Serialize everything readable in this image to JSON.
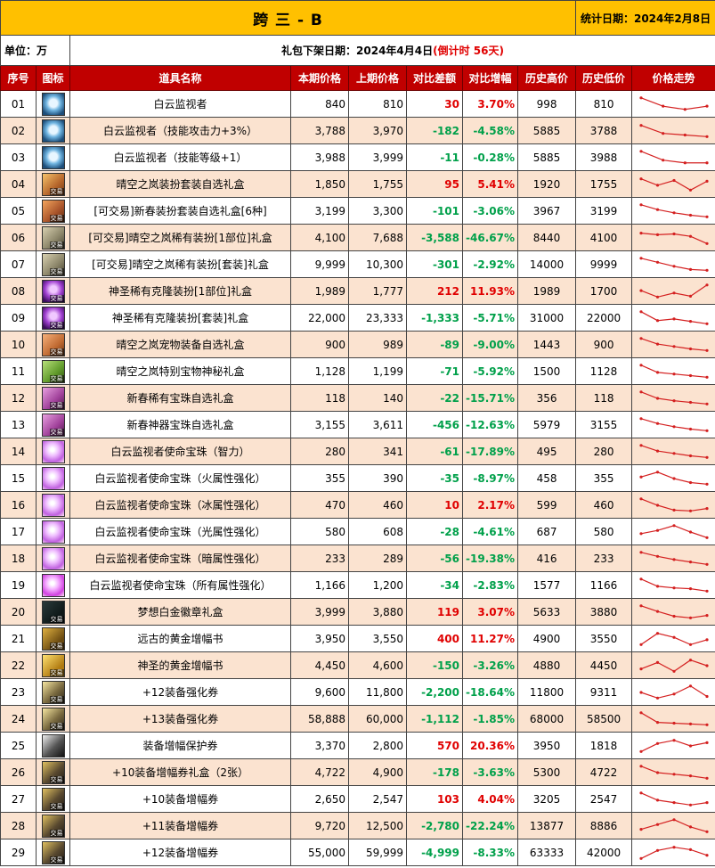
{
  "title": "跨 三 - B",
  "stat_date": "统计日期：2024年2月8日",
  "unit": "单位：万",
  "release_prefix": "礼包下架日期：2024年4月4日",
  "release_countdown": "(倒计时 56天)",
  "headers": [
    "序号",
    "图标",
    "道具名称",
    "本期价格",
    "上期价格",
    "对比差额",
    "对比增幅",
    "历史高价",
    "历史低价",
    "价格走势"
  ],
  "icon_tag": "交易",
  "colors": {
    "title_bg": "#ffc000",
    "header_bg": "#c00000",
    "alt_row": "#fbe3d0",
    "up": "#e00000",
    "down": "#00a04a",
    "trend_line": "#d42020"
  },
  "rows": [
    {
      "no": "01",
      "icon": "cloud-watcher-armor-icon",
      "name": "白云监视者",
      "cur": "840",
      "prev": "810",
      "diff": "30",
      "pct": "3.70%",
      "high": "998",
      "low": "810",
      "trend": [
        0.1,
        0.62,
        0.82,
        0.62
      ]
    },
    {
      "no": "02",
      "icon": "cloud-watcher-armor-icon",
      "name": "白云监视者（技能攻击力+3%）",
      "cur": "3,788",
      "prev": "3,970",
      "diff": "-182",
      "pct": "-4.58%",
      "high": "5885",
      "low": "3788",
      "trend": [
        0.15,
        0.65,
        0.75,
        0.85
      ]
    },
    {
      "no": "03",
      "icon": "cloud-watcher-armor-icon",
      "name": "白云监视者（技能等级+1）",
      "cur": "3,988",
      "prev": "3,999",
      "diff": "-11",
      "pct": "-0.28%",
      "high": "5885",
      "low": "3988",
      "trend": [
        0.1,
        0.65,
        0.82,
        0.82
      ]
    },
    {
      "no": "04",
      "icon": "clear-sky-avatar-box-icon",
      "name": "晴空之岚装扮套装自选礼盒",
      "cur": "1,850",
      "prev": "1,755",
      "diff": "95",
      "pct": "5.41%",
      "high": "1920",
      "low": "1755",
      "trend": [
        0.15,
        0.55,
        0.25,
        0.85,
        0.3
      ]
    },
    {
      "no": "05",
      "icon": "spring-avatar-box-icon",
      "name": "[可交易]新春装扮套装自选礼盒[6种]",
      "cur": "3,199",
      "prev": "3,300",
      "diff": "-101",
      "pct": "-3.06%",
      "high": "3967",
      "low": "3199",
      "trend": [
        0.1,
        0.4,
        0.6,
        0.75,
        0.85
      ]
    },
    {
      "no": "06",
      "icon": "rare-avatar-box-icon",
      "name": "[可交易]晴空之岚稀有装扮[1部位]礼盒",
      "cur": "4,100",
      "prev": "7,688",
      "diff": "-3,588",
      "pct": "-46.67%",
      "high": "8440",
      "low": "4100",
      "trend": [
        0.2,
        0.3,
        0.25,
        0.4,
        0.85
      ]
    },
    {
      "no": "07",
      "icon": "rare-avatar-set-box-icon",
      "name": "[可交易]晴空之岚稀有装扮[套装]礼盒",
      "cur": "9,999",
      "prev": "10,300",
      "diff": "-301",
      "pct": "-2.92%",
      "high": "14000",
      "low": "9999",
      "trend": [
        0.1,
        0.35,
        0.6,
        0.8,
        0.85
      ]
    },
    {
      "no": "08",
      "icon": "divine-clone-avatar-icon",
      "name": "神圣稀有克隆装扮[1部位]礼盒",
      "cur": "1,989",
      "prev": "1,777",
      "diff": "212",
      "pct": "11.93%",
      "high": "1989",
      "low": "1700",
      "trend": [
        0.45,
        0.85,
        0.6,
        0.8,
        0.1
      ]
    },
    {
      "no": "09",
      "icon": "divine-clone-set-icon",
      "name": "神圣稀有克隆装扮[套装]礼盒",
      "cur": "22,000",
      "prev": "23,333",
      "diff": "-1,333",
      "pct": "-5.71%",
      "high": "31000",
      "low": "22000",
      "trend": [
        0.1,
        0.65,
        0.55,
        0.7,
        0.85
      ]
    },
    {
      "no": "10",
      "icon": "pet-equipment-box-icon",
      "name": "晴空之岚宠物装备自选礼盒",
      "cur": "900",
      "prev": "989",
      "diff": "-89",
      "pct": "-9.00%",
      "high": "1443",
      "low": "900",
      "trend": [
        0.1,
        0.45,
        0.6,
        0.75,
        0.85
      ]
    },
    {
      "no": "11",
      "icon": "pet-treasure-box-icon",
      "name": "晴空之岚特别宝物神秘礼盒",
      "cur": "1,128",
      "prev": "1,199",
      "diff": "-71",
      "pct": "-5.92%",
      "high": "1500",
      "low": "1128",
      "trend": [
        0.1,
        0.55,
        0.65,
        0.75,
        0.85
      ]
    },
    {
      "no": "12",
      "icon": "spring-gem-box-icon",
      "name": "新春稀有宝珠自选礼盒",
      "cur": "118",
      "prev": "140",
      "diff": "-22",
      "pct": "-15.71%",
      "high": "356",
      "low": "118",
      "trend": [
        0.1,
        0.5,
        0.65,
        0.75,
        0.85
      ]
    },
    {
      "no": "13",
      "icon": "spring-artifact-gem-box-icon",
      "name": "新春神器宝珠自选礼盒",
      "cur": "3,155",
      "prev": "3,611",
      "diff": "-456",
      "pct": "-12.63%",
      "high": "5979",
      "low": "3155",
      "trend": [
        0.1,
        0.4,
        0.6,
        0.75,
        0.85
      ]
    },
    {
      "no": "14",
      "icon": "mission-orb-icon",
      "name": "白云监视者使命宝珠（智力）",
      "cur": "280",
      "prev": "341",
      "diff": "-61",
      "pct": "-17.89%",
      "high": "495",
      "low": "280",
      "trend": [
        0.1,
        0.45,
        0.6,
        0.75,
        0.85
      ]
    },
    {
      "no": "15",
      "icon": "mission-orb-icon",
      "name": "白云监视者使命宝珠（火属性强化）",
      "cur": "355",
      "prev": "390",
      "diff": "-35",
      "pct": "-8.97%",
      "high": "458",
      "low": "355",
      "trend": [
        0.4,
        0.1,
        0.5,
        0.75,
        0.85
      ]
    },
    {
      "no": "16",
      "icon": "mission-orb-icon",
      "name": "白云监视者使命宝珠（冰属性强化）",
      "cur": "470",
      "prev": "460",
      "diff": "10",
      "pct": "2.17%",
      "high": "599",
      "low": "460",
      "trend": [
        0.1,
        0.5,
        0.8,
        0.85,
        0.7
      ]
    },
    {
      "no": "17",
      "icon": "mission-orb-icon",
      "name": "白云监视者使命宝珠（光属性强化）",
      "cur": "580",
      "prev": "608",
      "diff": "-28",
      "pct": "-4.61%",
      "high": "687",
      "low": "580",
      "trend": [
        0.6,
        0.4,
        0.1,
        0.5,
        0.85
      ]
    },
    {
      "no": "18",
      "icon": "mission-orb-icon",
      "name": "白云监视者使命宝珠（暗属性强化）",
      "cur": "233",
      "prev": "289",
      "diff": "-56",
      "pct": "-19.38%",
      "high": "416",
      "low": "233",
      "trend": [
        0.1,
        0.35,
        0.55,
        0.7,
        0.85
      ]
    },
    {
      "no": "19",
      "icon": "mission-orb-all-icon",
      "name": "白云监视者使命宝珠（所有属性强化）",
      "cur": "1,166",
      "prev": "1,200",
      "diff": "-34",
      "pct": "-2.83%",
      "high": "1577",
      "low": "1166",
      "trend": [
        0.1,
        0.55,
        0.65,
        0.7,
        0.85
      ]
    },
    {
      "no": "20",
      "icon": "platinum-emblem-box-icon",
      "name": "梦想白金徽章礼盒",
      "cur": "3,999",
      "prev": "3,880",
      "diff": "119",
      "pct": "3.07%",
      "high": "5633",
      "low": "3880",
      "trend": [
        0.1,
        0.45,
        0.75,
        0.85,
        0.7
      ]
    },
    {
      "no": "21",
      "icon": "ancient-amplify-book-icon",
      "name": "远古的黄金增幅书",
      "cur": "3,950",
      "prev": "3,550",
      "diff": "400",
      "pct": "11.27%",
      "high": "4900",
      "low": "3550",
      "trend": [
        0.85,
        0.15,
        0.4,
        0.85,
        0.55
      ]
    },
    {
      "no": "22",
      "icon": "divine-amplify-book-icon",
      "name": "神圣的黄金增幅书",
      "cur": "4,450",
      "prev": "4,600",
      "diff": "-150",
      "pct": "-3.26%",
      "high": "4880",
      "low": "4450",
      "trend": [
        0.7,
        0.3,
        0.85,
        0.15,
        0.5
      ]
    },
    {
      "no": "23",
      "icon": "plus12-reinforce-ticket-icon",
      "name": "+12装备强化券",
      "cur": "9,600",
      "prev": "11,800",
      "diff": "-2,200",
      "pct": "-18.64%",
      "high": "11800",
      "low": "9311",
      "trend": [
        0.5,
        0.85,
        0.6,
        0.1,
        0.75
      ]
    },
    {
      "no": "24",
      "icon": "plus13-reinforce-ticket-icon",
      "name": "+13装备强化券",
      "cur": "58,888",
      "prev": "60,000",
      "diff": "-1,112",
      "pct": "-1.85%",
      "high": "68000",
      "low": "58500",
      "trend": [
        0.1,
        0.7,
        0.75,
        0.8,
        0.85
      ]
    },
    {
      "no": "25",
      "icon": "amplify-protection-ticket-icon",
      "name": "装备增幅保护券",
      "cur": "3,370",
      "prev": "2,800",
      "diff": "570",
      "pct": "20.36%",
      "high": "3950",
      "low": "1818",
      "trend": [
        0.85,
        0.35,
        0.15,
        0.5,
        0.3
      ]
    },
    {
      "no": "26",
      "icon": "plus10-amplify-box-icon",
      "name": "+10装备增幅券礼盒（2张）",
      "cur": "4,722",
      "prev": "4,900",
      "diff": "-178",
      "pct": "-3.63%",
      "high": "5300",
      "low": "4722",
      "trend": [
        0.1,
        0.5,
        0.6,
        0.7,
        0.85
      ]
    },
    {
      "no": "27",
      "icon": "plus10-amplify-ticket-icon",
      "name": "+10装备增幅券",
      "cur": "2,650",
      "prev": "2,547",
      "diff": "103",
      "pct": "4.04%",
      "high": "3205",
      "low": "2547",
      "trend": [
        0.1,
        0.55,
        0.7,
        0.85,
        0.7
      ]
    },
    {
      "no": "28",
      "icon": "plus11-amplify-ticket-icon",
      "name": "+11装备增幅券",
      "cur": "9,720",
      "prev": "12,500",
      "diff": "-2,780",
      "pct": "-22.24%",
      "high": "13877",
      "low": "8886",
      "trend": [
        0.7,
        0.4,
        0.1,
        0.55,
        0.85
      ]
    },
    {
      "no": "29",
      "icon": "plus12-amplify-ticket-icon",
      "name": "+12装备增幅券",
      "cur": "55,000",
      "prev": "59,999",
      "diff": "-4,999",
      "pct": "-8.33%",
      "high": "63333",
      "low": "42000",
      "trend": [
        0.85,
        0.35,
        0.15,
        0.3,
        0.65
      ]
    }
  ]
}
